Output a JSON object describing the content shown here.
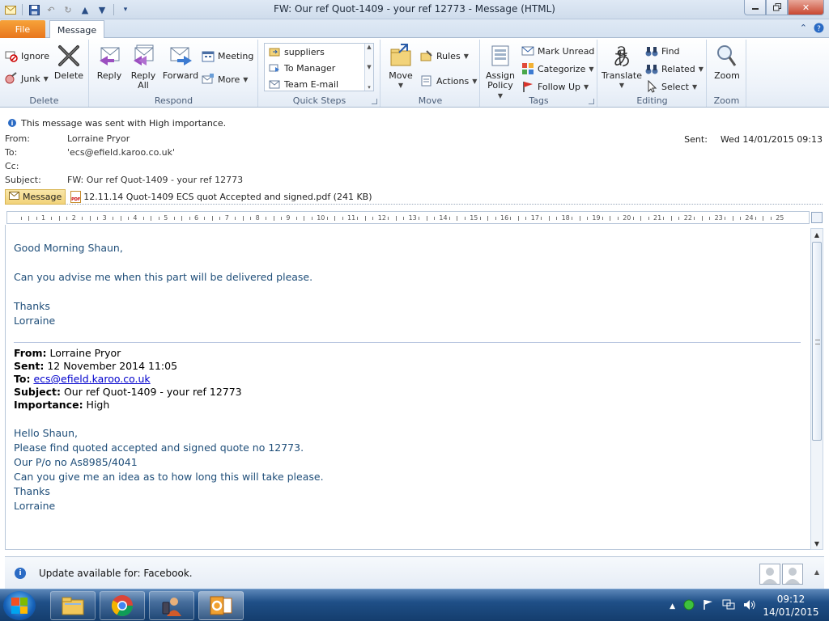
{
  "window": {
    "title": "FW: Our ref Quot-1409 - your ref 12773  -  Message (HTML)"
  },
  "tabs": {
    "file": "File",
    "message": "Message"
  },
  "ribbon": {
    "delete_group": {
      "label": "Delete",
      "ignore": "Ignore",
      "junk": "Junk",
      "delete": "Delete"
    },
    "respond_group": {
      "label": "Respond",
      "reply": "Reply",
      "reply_all_1": "Reply",
      "reply_all_2": "All",
      "forward": "Forward",
      "meeting": "Meeting",
      "more": "More"
    },
    "quick_steps": {
      "label": "Quick Steps",
      "items": [
        "suppliers",
        "To Manager",
        "Team E-mail"
      ]
    },
    "move_group": {
      "label": "Move",
      "move": "Move",
      "rules": "Rules",
      "actions": "Actions"
    },
    "tags_group": {
      "label": "Tags",
      "assign_1": "Assign",
      "assign_2": "Policy",
      "mark_unread": "Mark Unread",
      "categorize": "Categorize",
      "follow_up": "Follow Up"
    },
    "editing_group": {
      "label": "Editing",
      "translate": "Translate",
      "find": "Find",
      "related": "Related",
      "select": "Select"
    },
    "zoom_group": {
      "label": "Zoom",
      "zoom": "Zoom"
    }
  },
  "header": {
    "importance_notice": "This message was sent with High importance.",
    "from_label": "From:",
    "from_value": "Lorraine Pryor",
    "to_label": "To:",
    "to_value": "'ecs@efield.karoo.co.uk'",
    "cc_label": "Cc:",
    "subject_label": "Subject:",
    "subject_value": "FW: Our ref Quot-1409 - your ref 12773",
    "sent_label": "Sent:",
    "sent_value": "Wed 14/01/2015 09:13"
  },
  "attachments": {
    "message_chip": "Message",
    "pdf_name": "12.11.14 Quot-1409 ECS quot Accepted and signed.pdf (241 KB)"
  },
  "ruler": {
    "numbers": [
      "1",
      "2",
      "3",
      "4",
      "5",
      "6",
      "7",
      "8",
      "9",
      "10",
      "11",
      "12",
      "13",
      "14",
      "15",
      "16",
      "17",
      "18",
      "19",
      "20",
      "21",
      "22",
      "23",
      "24",
      "25"
    ]
  },
  "body": {
    "greeting": "Good Morning Shaun,",
    "line1": "Can you advise me when this part will be delivered please.",
    "thanks": "Thanks",
    "sign": "Lorraine",
    "fw_from_label": "From:",
    "fw_from_value": " Lorraine Pryor",
    "fw_sent_label": "Sent:",
    "fw_sent_value": " 12 November 2014 11:05",
    "fw_to_label": "To:",
    "fw_to_value": "ecs@efield.karoo.co.uk",
    "fw_subject_label": "Subject:",
    "fw_subject_value": " Our ref Quot-1409 - your ref 12773",
    "fw_importance_label": "Importance:",
    "fw_importance_value": " High",
    "q_hello": "Hello Shaun,",
    "q_line1": "Please find quoted accepted and signed quote no 12773.",
    "q_line2": "Our P/o no As8985/4041",
    "q_line3": "Can you give me an idea as to how long this will take please.",
    "q_thanks": "Thanks",
    "q_sign": "Lorraine"
  },
  "people_pane": {
    "notice": "Update available for: Facebook."
  },
  "taskbar": {
    "time": "09:12",
    "date": "14/01/2015"
  },
  "colors": {
    "body_text": "#1f4e79",
    "file_tab": "#e8761d",
    "taskbar": "#1f4f87"
  }
}
